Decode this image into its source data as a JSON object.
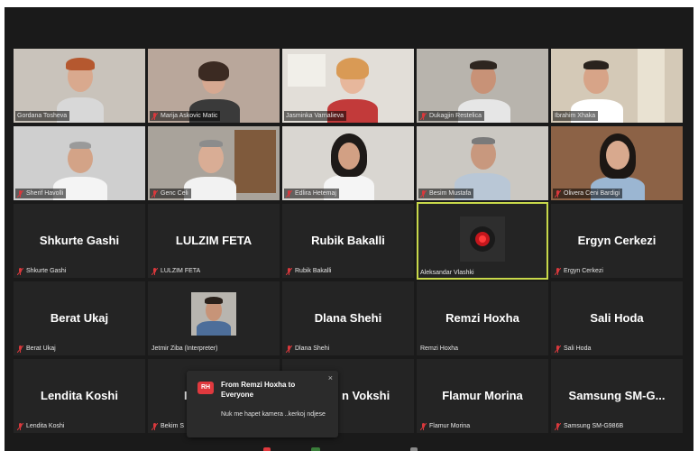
{
  "colors": {
    "accent_active": "#c8d84a",
    "mute_red": "#d9383c",
    "avatar_red": "#e0393e"
  },
  "video_tiles": [
    {
      "name": "Gordana Tosheva"
    },
    {
      "name": "Marija Askovic Matic"
    },
    {
      "name": "Jasminka Varnalieva"
    },
    {
      "name": "Dukagjin Restelica"
    },
    {
      "name": "Ibrahim Xhaka"
    },
    {
      "name": "Sherif Havolli"
    },
    {
      "name": "Genc Celi"
    },
    {
      "name": "Edlira Hetemaj"
    },
    {
      "name": "Besim Mustafa"
    },
    {
      "name": "Olivera Ceni Bardigi"
    }
  ],
  "name_tiles": [
    {
      "title": "Shkurte Gashi",
      "label": "Shkurte Gashi"
    },
    {
      "title": "LULZIM FETA",
      "label": "LULZIM FETA"
    },
    {
      "title": "Rubik Bakalli",
      "label": "Rubik Bakalli"
    },
    {
      "title": "",
      "label": "Aleksandar Vlashki"
    },
    {
      "title": "Ergyn Cerkezi",
      "label": "Ergyn Cerkezi"
    },
    {
      "title": "Berat Ukaj",
      "label": "Berat Ukaj"
    },
    {
      "title": "",
      "label": "Jetmir Ziba (Interpreter)"
    },
    {
      "title": "Dlana Shehi",
      "label": "Dlana Shehi"
    },
    {
      "title": "Remzi Hoxha",
      "label": "Remzi Hoxha"
    },
    {
      "title": "Sali Hoda",
      "label": "Sali Hoda"
    },
    {
      "title": "Lendita Koshi",
      "label": "Lendita Koshi"
    },
    {
      "title": "I",
      "label": "Bekim S"
    },
    {
      "title": "n Vokshi",
      "label": ""
    },
    {
      "title": "Flamur Morina",
      "label": "Flamur Morina"
    },
    {
      "title": "Samsung  SM-G...",
      "label": "Samsung SM-G986B"
    }
  ],
  "chat_popup": {
    "avatar_initials": "RH",
    "title": "From Remzi Hoxha to Everyone",
    "message": "Nuk me hapet kamera ..kerkoj ndjese",
    "close": "×"
  },
  "icons": {
    "mute": "muted-microphone-icon",
    "close": "close-icon"
  }
}
